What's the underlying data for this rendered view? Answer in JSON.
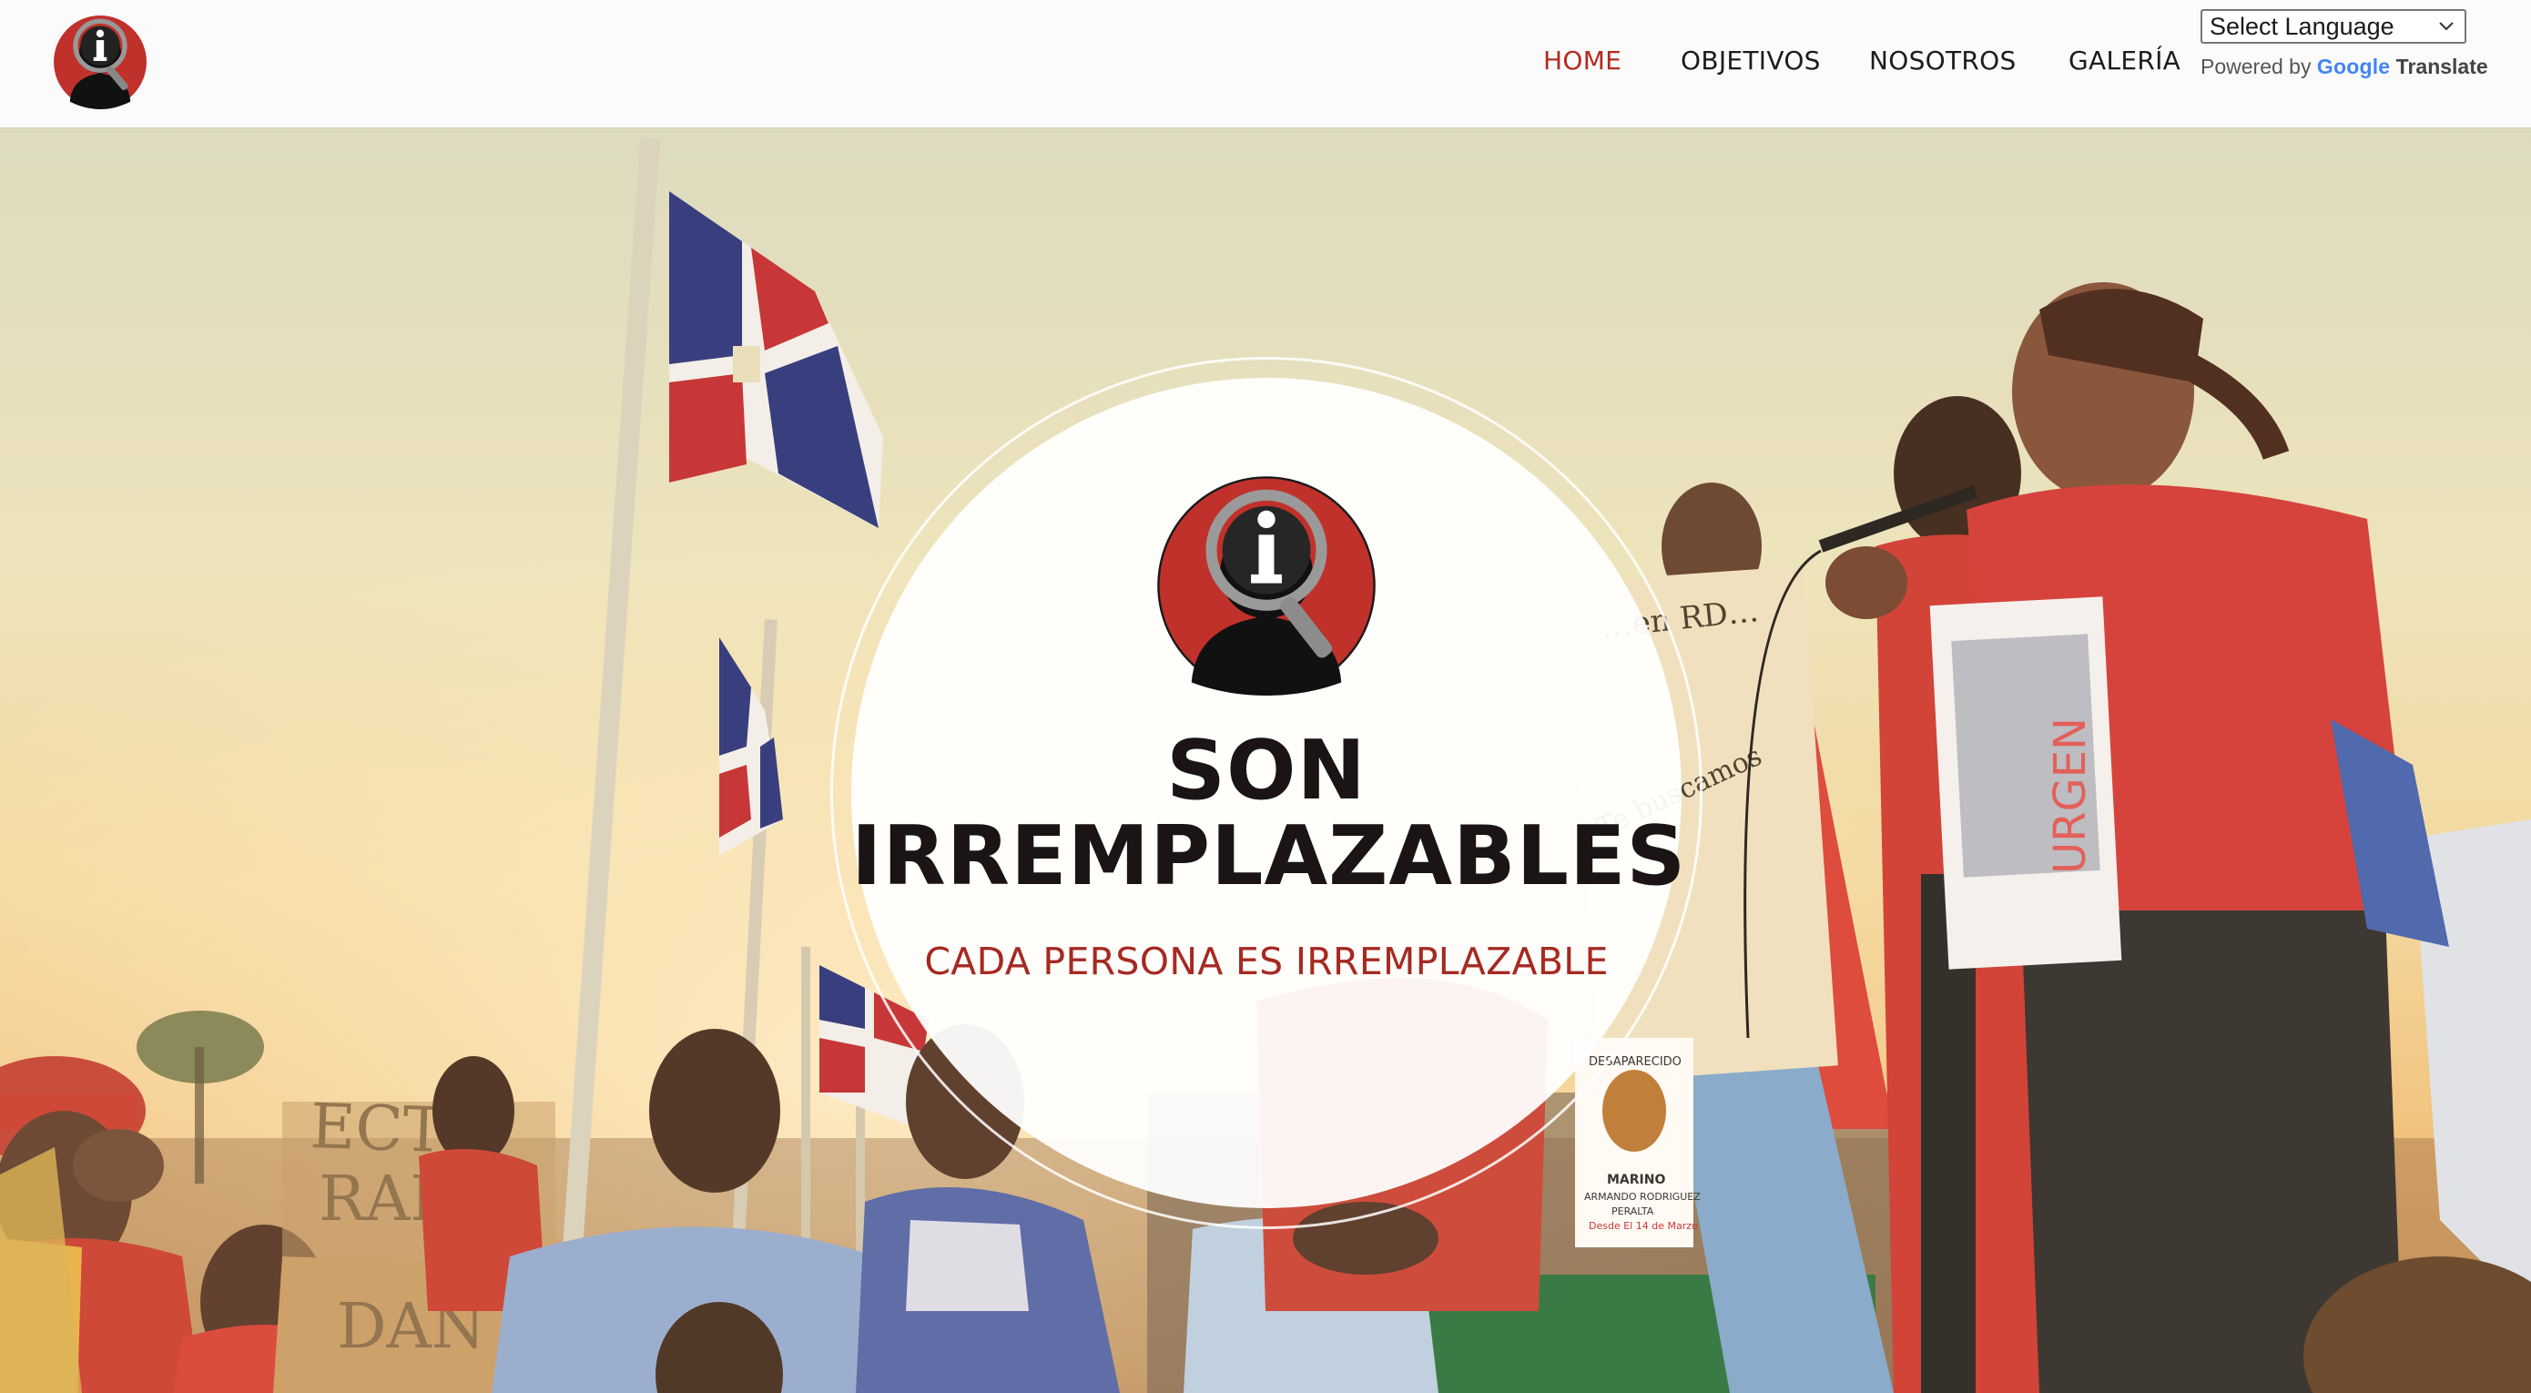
{
  "header": {
    "logo_name": "magnifier-person-logo",
    "nav": [
      {
        "label": "HOME",
        "active": true
      },
      {
        "label": "OBJETIVOS",
        "active": false
      },
      {
        "label": "NOSOTROS",
        "active": false
      },
      {
        "label": "GALERÍA",
        "active": false
      }
    ],
    "translate": {
      "select_value": "Select Language",
      "powered_prefix": "Powered by ",
      "google": "Google",
      "translate_word": "Translate"
    }
  },
  "hero": {
    "title_line1": "SON",
    "title_line2": "IRREMPLAZABLES",
    "subtitle": "CADA PERSONA ES IRREMPLAZABLE",
    "background_description": "protest-crowd-with-dominican-flags",
    "sign_texts": {
      "sign_left_1": "ECTO",
      "sign_left_2": "RADO",
      "sign_left_3": "DAN",
      "poster_name": "MARINO",
      "poster_fullname": "ARMANDO RODRIGUEZ",
      "poster_surname": "PERALTA",
      "poster_date": "Desde El 14 de Marzo",
      "poster_header": "DESAPARECIDO",
      "urgente": "URGEN"
    }
  },
  "colors": {
    "accent_red": "#b32a22",
    "logo_red": "#c0312b",
    "title_dark": "#1b1414",
    "subtitle_red": "#a52a22",
    "nav_text": "#1c1c1c"
  }
}
